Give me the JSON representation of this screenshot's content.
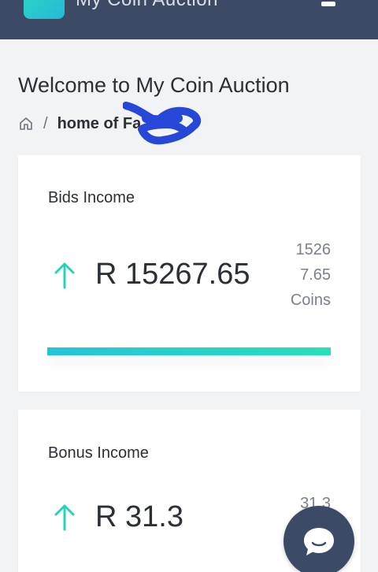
{
  "header": {
    "app_title": "My Coin Auction",
    "logo_icon": "coin-logo-icon",
    "menu_icon": "hamburger-menu-icon",
    "background_color": "#3d4a66"
  },
  "page": {
    "title": "Welcome to My Coin Auction",
    "breadcrumb": {
      "home_icon": "home-icon",
      "separator": "/",
      "current": "home of Fa"
    }
  },
  "cards": [
    {
      "label": "Bids Income",
      "trend_icon": "arrow-up-icon",
      "amount": "R 15267.65",
      "coins_line1": "1526",
      "coins_line2": "7.65",
      "coins_unit": "Coins",
      "progress_fraction": 1.0,
      "progress_colors": [
        "#25c3d9",
        "#27e0b8"
      ]
    },
    {
      "label": "Bonus Income",
      "trend_icon": "arrow-up-icon",
      "amount": "R 31.3",
      "coins_line1": "31.3"
    }
  ],
  "chat": {
    "icon": "chat-bubble-icon"
  },
  "colors": {
    "accent": "#27d3b4",
    "header": "#3d4a66",
    "background": "#f2f3f5"
  }
}
